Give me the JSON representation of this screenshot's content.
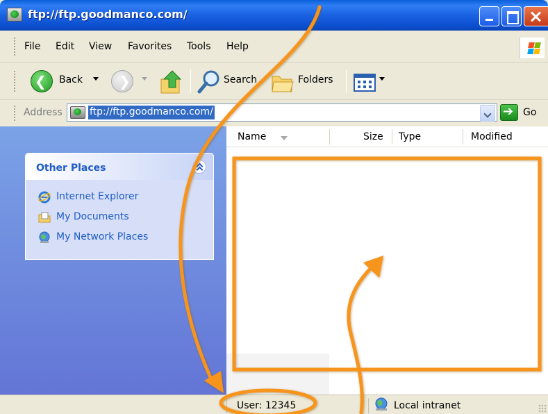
{
  "window": {
    "title": "ftp://ftp.goodmanco.com/"
  },
  "menu": {
    "items": [
      "File",
      "Edit",
      "View",
      "Favorites",
      "Tools",
      "Help"
    ]
  },
  "toolbar": {
    "back_label": "Back",
    "search_label": "Search",
    "folders_label": "Folders"
  },
  "address": {
    "label": "Address",
    "value": "ftp://ftp.goodmanco.com/",
    "go_label": "Go"
  },
  "sidebar": {
    "section_title": "Other Places",
    "items": [
      {
        "label": "Internet Explorer",
        "icon": "internet-explorer-icon"
      },
      {
        "label": "My Documents",
        "icon": "my-documents-icon"
      },
      {
        "label": "My Network Places",
        "icon": "network-places-icon"
      }
    ]
  },
  "list": {
    "columns": [
      "Name",
      "Size",
      "Type",
      "Modified"
    ]
  },
  "status": {
    "user": "User: 12345",
    "zone": "Local intranet"
  },
  "colors": {
    "title_bar": "#0a5fd8",
    "sidebar": "#7ba2e7",
    "link": "#215dc6",
    "annotation": "#f7941d",
    "selection": "#316ac5"
  }
}
